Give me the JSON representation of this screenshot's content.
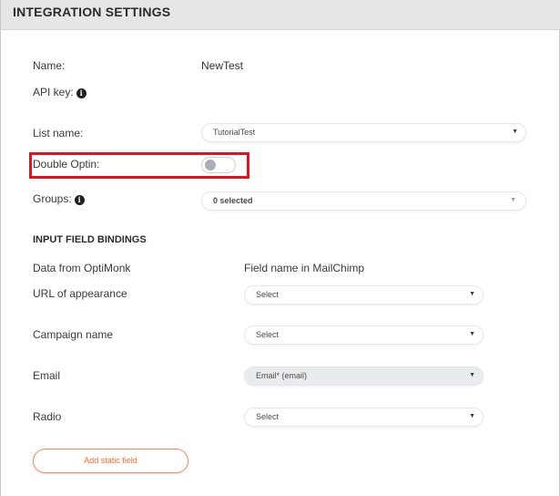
{
  "header": {
    "title": "INTEGRATION SETTINGS"
  },
  "fields": {
    "name_label": "Name:",
    "name_value": "NewTest",
    "api_key_label": "API key:",
    "list_name_label": "List name:",
    "list_name_value": "TutorialTest",
    "double_optin_label": "Double Optin:",
    "double_optin_on": false,
    "groups_label": "Groups:",
    "groups_value": "0 selected"
  },
  "bindings": {
    "section_title": "INPUT FIELD BINDINGS",
    "col_source": "Data from OptiMonk",
    "col_target": "Field name in MailChimp",
    "rows": [
      {
        "label": "URL of appearance",
        "value": "Select"
      },
      {
        "label": "Campaign name",
        "value": "Select"
      },
      {
        "label": "Email",
        "value": "Email* (email)"
      },
      {
        "label": "Radio",
        "value": "Select"
      }
    ]
  },
  "actions": {
    "add_static_field": "Add static field"
  },
  "icons": {
    "info": "info-icon",
    "dropdown": "caret-down-icon"
  },
  "colors": {
    "highlight": "#e0141e",
    "accent": "#ee6b35",
    "header_bg": "#e6e6e6"
  }
}
